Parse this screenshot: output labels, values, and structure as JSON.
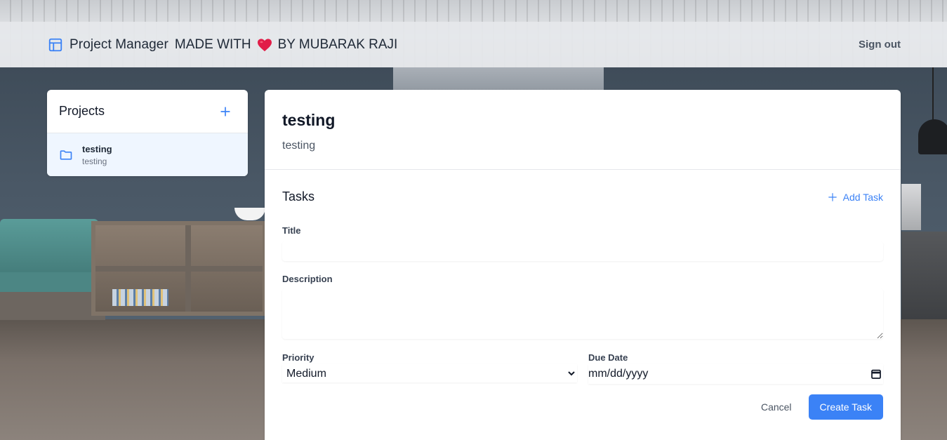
{
  "header": {
    "title": "Project Manager",
    "made_with": "MADE WITH",
    "author": "BY MUBARAK RAJI",
    "signout_label": "Sign out",
    "icons": {
      "brand": "layout-icon",
      "heart": "heart-icon"
    }
  },
  "sidebar": {
    "title": "Projects",
    "add_icon": "plus-icon",
    "items": [
      {
        "name": "testing",
        "description": "testing",
        "icon": "folder-icon",
        "selected": true
      }
    ]
  },
  "main": {
    "project_title": "testing",
    "project_description": "testing",
    "tasks": {
      "title": "Tasks",
      "add_task_label": "Add Task",
      "form": {
        "title_label": "Title",
        "title_value": "",
        "description_label": "Description",
        "description_value": "",
        "priority_label": "Priority",
        "priority_value": "Medium",
        "due_date_label": "Due Date",
        "due_date_placeholder": "mm/dd/yyyy",
        "cancel_label": "Cancel",
        "create_label": "Create Task"
      }
    }
  },
  "colors": {
    "accent": "#3b82f6",
    "selected_bg": "#eff6ff",
    "heart": "#e11d48"
  }
}
